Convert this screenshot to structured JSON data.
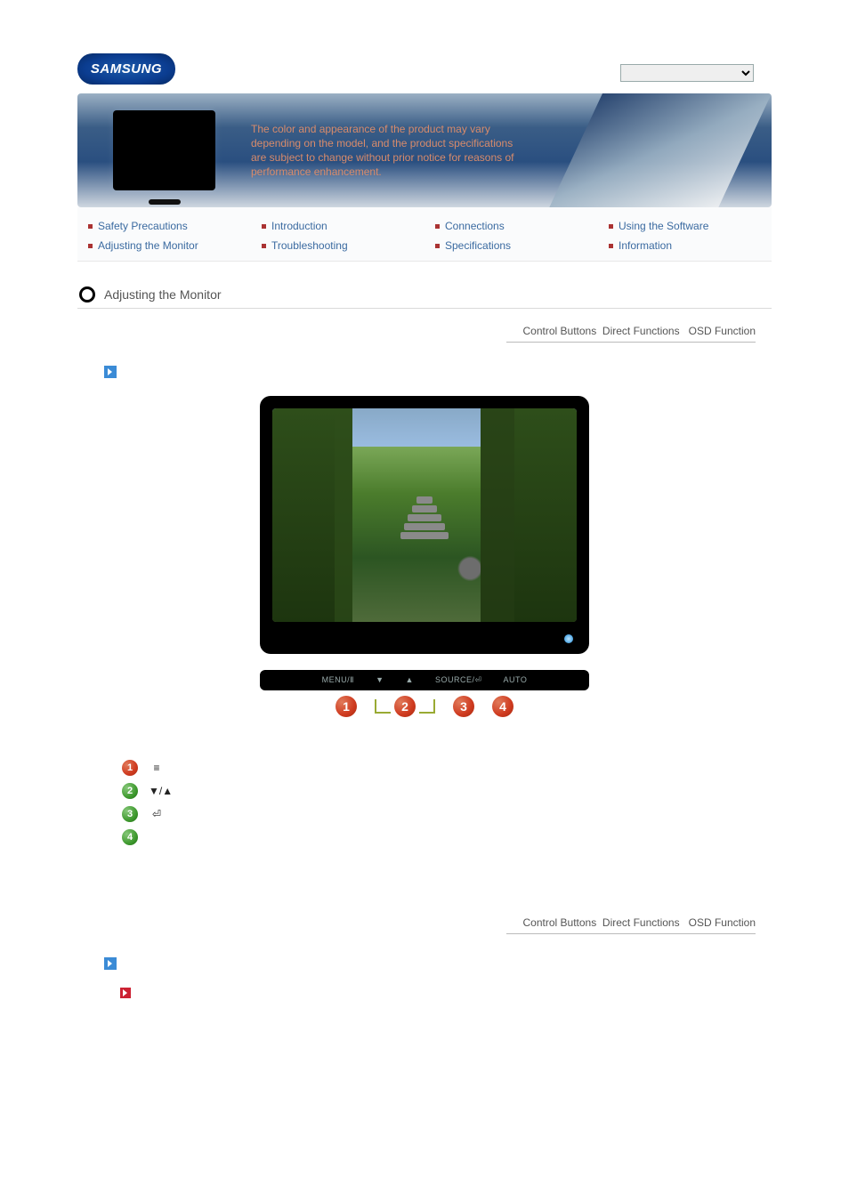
{
  "brand": "SAMSUNG",
  "hero_notice": "The color and appearance of the product may vary depending on the model, and the product specifications are subject to change without prior notice for reasons of performance enhancement.",
  "nav": {
    "r1c1": "Safety Precautions",
    "r1c2": "Introduction",
    "r1c3": "Connections",
    "r1c4": "Using the Software",
    "r2c1": "Adjusting the Monitor",
    "r2c2": "Troubleshooting",
    "r2c3": "Specifications",
    "r2c4": "Information"
  },
  "section_title": "Adjusting the Monitor",
  "tabs": {
    "t1": "Control Buttons",
    "t2": "Direct Functions",
    "t3": "OSD Function"
  },
  "strip": {
    "b1": "MENU/Ⅱ",
    "b2_left": "▼",
    "b2_right": "▲",
    "b3": "SOURCE/⏎",
    "b4": "AUTO"
  },
  "legend_icons": {
    "i1": "≡",
    "i2": "▼/▲",
    "i3": "⏎"
  }
}
